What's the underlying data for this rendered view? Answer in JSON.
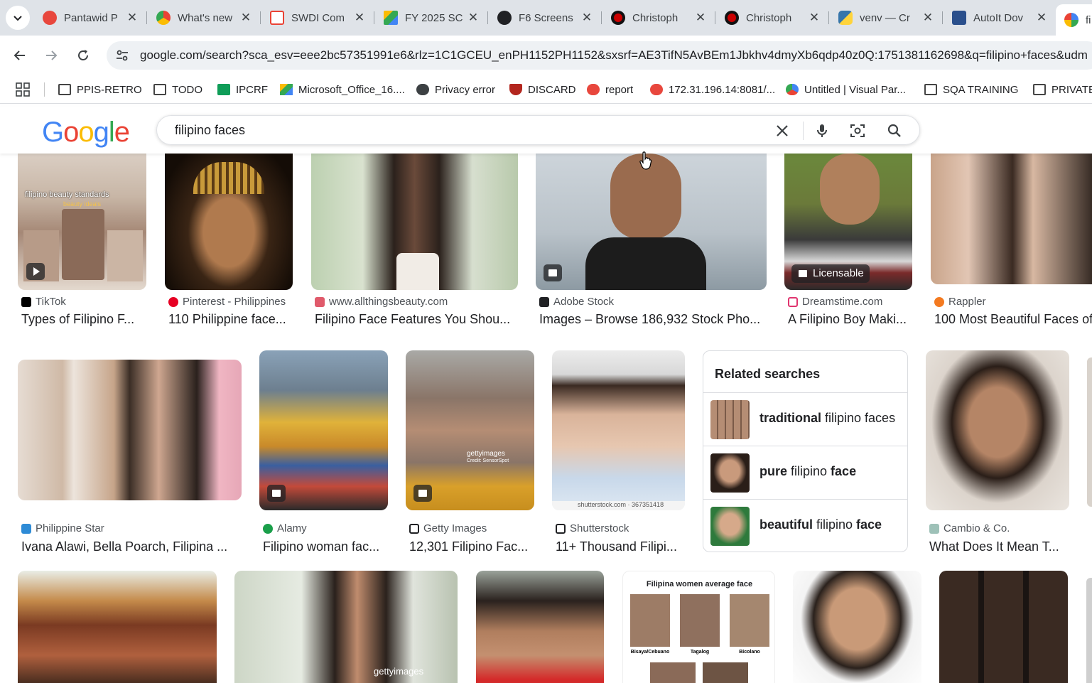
{
  "tabs": [
    {
      "title": "Pantawid P",
      "favicon_color": "#e8473d"
    },
    {
      "title": "What's new",
      "favicon_color": "#34a853"
    },
    {
      "title": "SWDI Com",
      "favicon_color": "#ea4335"
    },
    {
      "title": "FY 2025 SC",
      "favicon_color": "#fbbc04"
    },
    {
      "title": "F6 Screens",
      "favicon_color": "#202124"
    },
    {
      "title": "Christoph",
      "favicon_color": "#cc0000"
    },
    {
      "title": "Christoph",
      "favicon_color": "#cc0000"
    },
    {
      "title": "venv — Cr",
      "favicon_color": "#3776ab"
    },
    {
      "title": "AutoIt Dov",
      "favicon_color": "#2a4f8c"
    },
    {
      "title": "fi",
      "favicon_color": "#4285f4"
    }
  ],
  "toolbar": {
    "url": "google.com/search?sca_esv=eee2bc57351991e6&rlz=1C1GCEU_enPH1152PH1152&sxsrf=AE3TifN5AvBEm1Jbkhv4dmyXb6qdp40z0Q:1751381162698&q=filipino+faces&udm"
  },
  "bookmarks": [
    {
      "label": "PPIS-RETRO",
      "icon": "folder-icon"
    },
    {
      "label": "TODO",
      "icon": "folder-icon"
    },
    {
      "label": "IPCRF",
      "icon": "sheets-icon"
    },
    {
      "label": "Microsoft_Office_16....",
      "icon": "drive-icon"
    },
    {
      "label": "Privacy error",
      "icon": "globe-icon"
    },
    {
      "label": "DISCARD",
      "icon": "shield-icon"
    },
    {
      "label": "report",
      "icon": "heart-icon"
    },
    {
      "label": "172.31.196.14:8081/...",
      "icon": "heart-icon"
    },
    {
      "label": "Untitled | Visual Par...",
      "icon": "vp-icon"
    },
    {
      "label": "SQA TRAINING",
      "icon": "folder-icon"
    },
    {
      "label": "PRIVATE",
      "icon": "folder-icon"
    }
  ],
  "search": {
    "logo": "Google",
    "query": "filipino faces"
  },
  "row1": [
    {
      "source": "TikTok",
      "title": "Types of Filipino F...",
      "badge": "play"
    },
    {
      "source": "Pinterest - Philippines",
      "title": "110 Philippine face...",
      "badge": ""
    },
    {
      "source": "www.allthingsbeauty.com",
      "title": "Filipino Face Features You Shou...",
      "badge": ""
    },
    {
      "source": "Adobe Stock",
      "title": "Images – Browse 186,932 Stock Pho...",
      "badge": "image"
    },
    {
      "source": "Dreamstime.com",
      "title": "A Filipino Boy Maki...",
      "badge": "Licensable"
    },
    {
      "source": "Rappler",
      "title": "100 Most Beautiful Faces of",
      "badge": ""
    }
  ],
  "row2": [
    {
      "source": "Philippine Star",
      "title": "Ivana Alawi, Bella Poarch, Filipina ..."
    },
    {
      "source": "Alamy",
      "title": "Filipino woman fac..."
    },
    {
      "source": "Getty Images",
      "title": "12,301 Filipino Fac..."
    },
    {
      "source": "Shutterstock",
      "title": "11+ Thousand Filipi..."
    },
    {
      "source": "Cambio & Co.",
      "title": "What Does It Mean T..."
    }
  ],
  "thumb_texts": {
    "tiktok_overlay": "filipino beauty standards",
    "tiktok_sub": "beauty ideals",
    "getty_watermark": "gettyimages",
    "getty_credit": "Credit: SensorSpot",
    "shutterstock_watermark": "shutterstock.com · 367351418",
    "chart_title": "Filipina women average face",
    "chart_labels": [
      "Bisaya/Cebuano",
      "Tagalog",
      "Bicolano"
    ]
  },
  "related": {
    "heading": "Related searches",
    "items": [
      {
        "bold": "traditional",
        "plain": " filipino faces"
      },
      {
        "bold": "pure",
        "plain": " filipino ",
        "bold2": "face"
      },
      {
        "bold": "beautiful",
        "plain": " filipino ",
        "bold2": "face"
      }
    ]
  }
}
